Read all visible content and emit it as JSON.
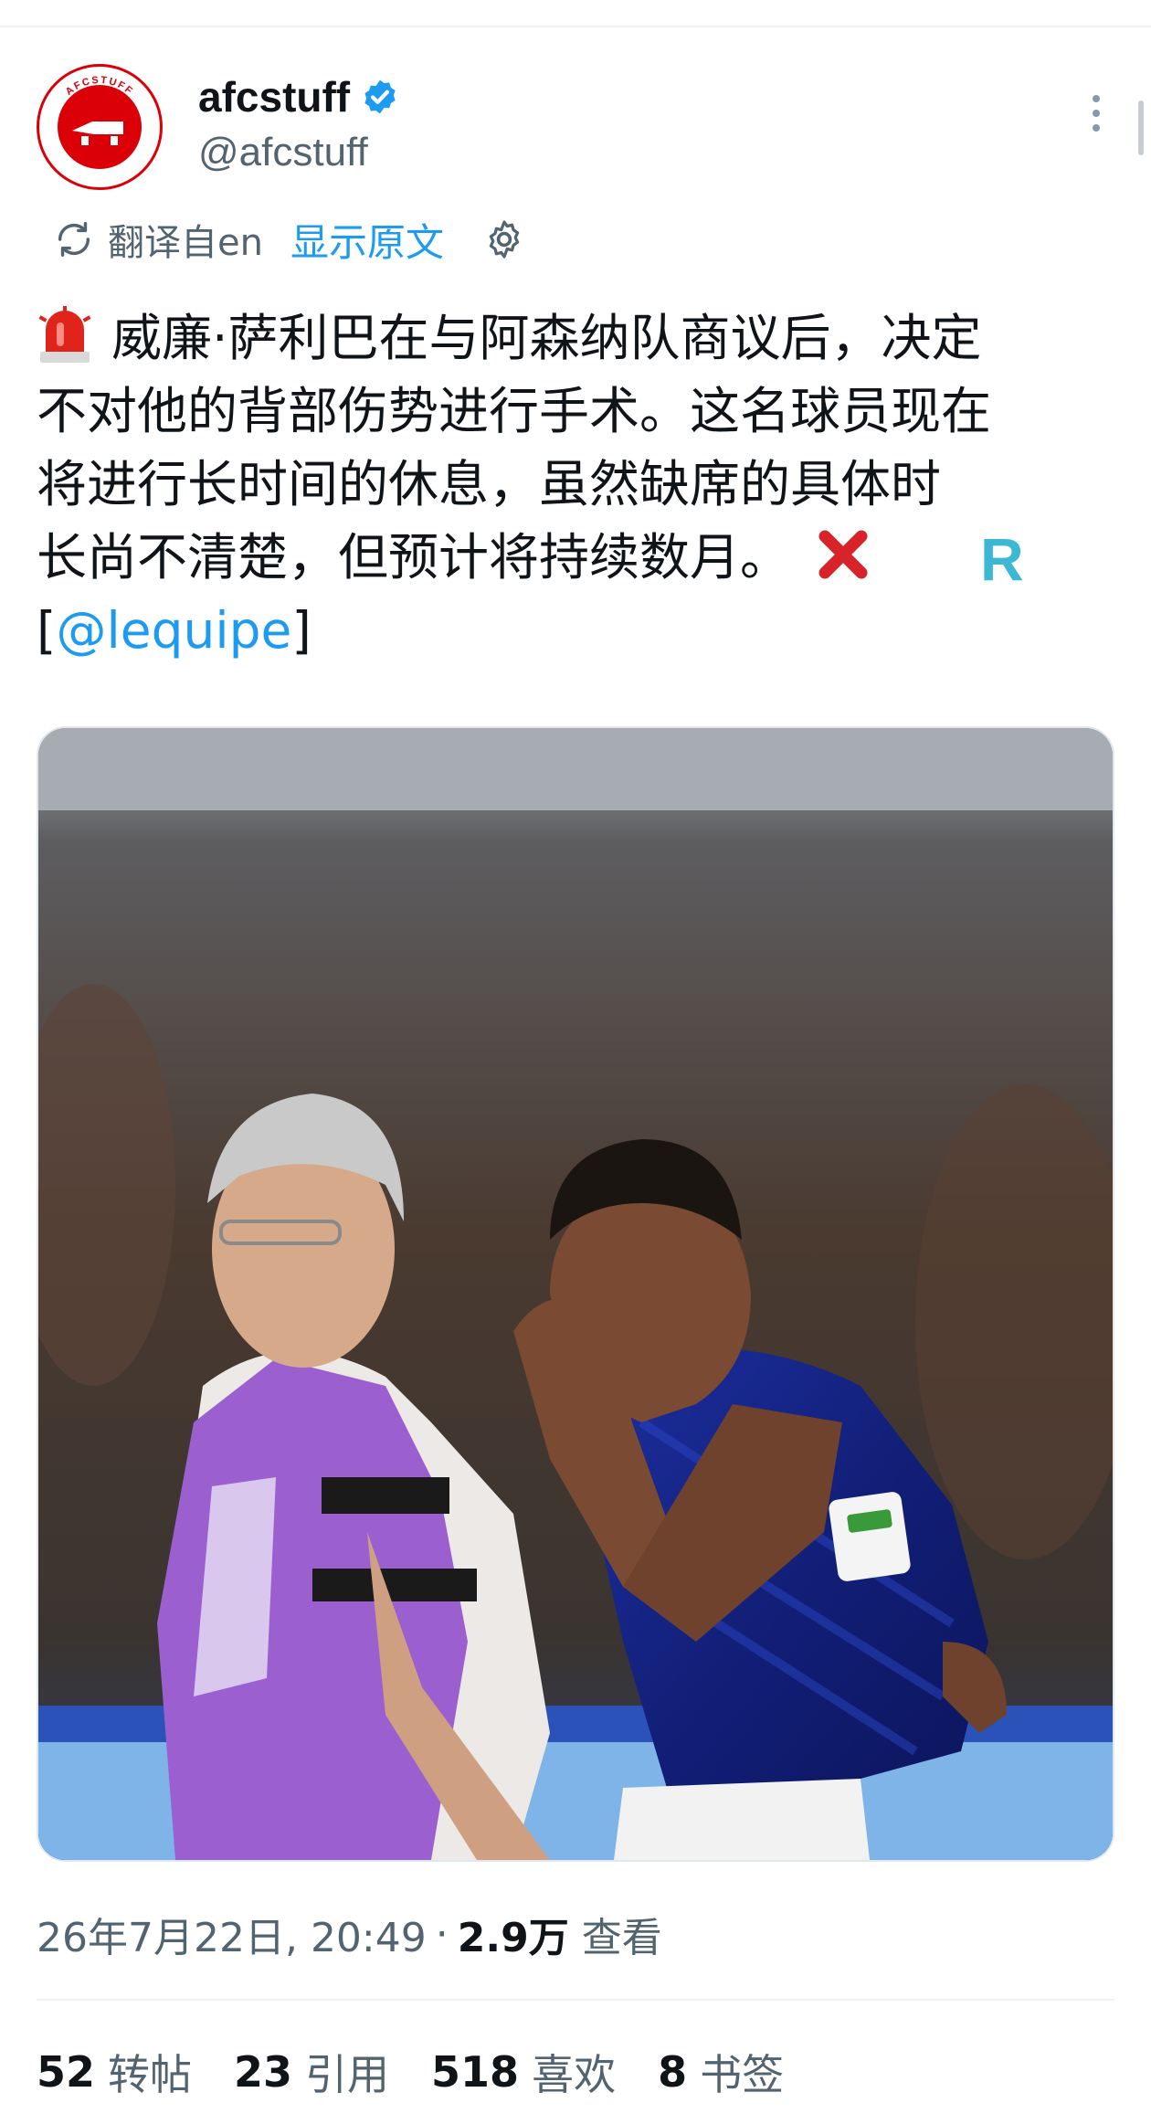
{
  "author": {
    "display_name": "afcstuff",
    "handle": "@afcstuff",
    "avatar_text": "AFCSTUFF",
    "verified": true
  },
  "translation": {
    "label": "翻译自en",
    "show_original": "显示原文"
  },
  "tweet": {
    "lines": [
      "威廉·萨利巴在与阿森纳队商议后，决定",
      "不对他的背部伤势进行手术。这名球员现在",
      "将进行长时间的休息，虽然缺席的具体时",
      "长尚不清楚，但预计将持续数月。"
    ],
    "source_letter": "R",
    "mention_open": "[",
    "mention": "@lequipe",
    "mention_close": "]"
  },
  "media": {
    "alt": "photo"
  },
  "meta": {
    "timestamp": "26年7月22日, 20:49",
    "separator": "·",
    "views_count": "2.9万",
    "views_label": "查看"
  },
  "stats": [
    {
      "count": "52",
      "label": "转帖"
    },
    {
      "count": "23",
      "label": "引用"
    },
    {
      "count": "518",
      "label": "喜欢"
    },
    {
      "count": "8",
      "label": "书签"
    }
  ],
  "colors": {
    "accent": "#1d9bf0",
    "text": "#0f1419",
    "secondary": "#536471",
    "arsenal_red": "#db0007"
  }
}
